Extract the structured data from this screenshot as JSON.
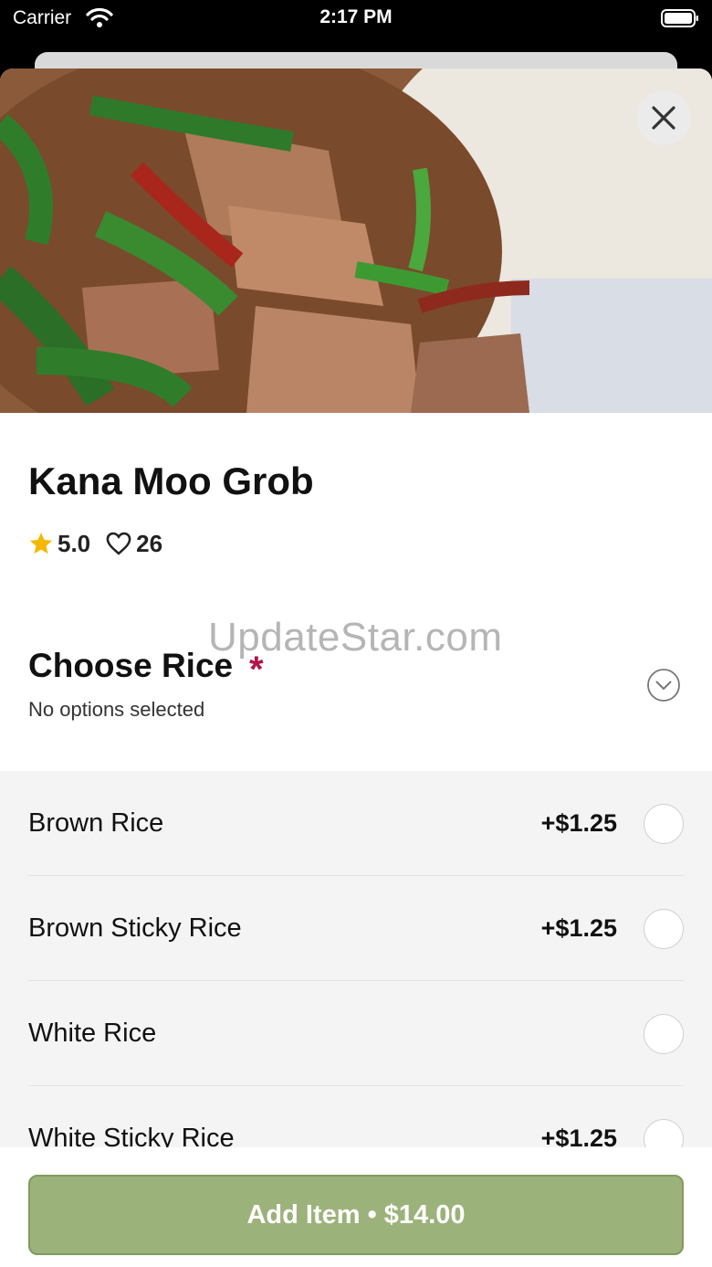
{
  "status_bar": {
    "carrier": "Carrier",
    "time": "2:17 PM"
  },
  "item": {
    "title": "Kana Moo Grob",
    "rating": "5.0",
    "likes": "26"
  },
  "watermark": "UpdateStar.com",
  "section": {
    "title": "Choose Rice",
    "required_mark": "*",
    "subtitle": "No options selected"
  },
  "options": [
    {
      "label": "Brown Rice",
      "price": "+$1.25"
    },
    {
      "label": "Brown Sticky Rice",
      "price": "+$1.25"
    },
    {
      "label": "White Rice",
      "price": ""
    },
    {
      "label": "White Sticky Rice",
      "price": "+$1.25"
    }
  ],
  "footer": {
    "add_button": "Add Item • $14.00"
  },
  "colors": {
    "accent_green": "#9cb27b",
    "required_red": "#b3124b",
    "star": "#f5b800"
  },
  "icons": [
    "wifi-icon",
    "battery-icon",
    "close-icon",
    "star-icon",
    "heart-icon",
    "chevron-down-icon"
  ]
}
